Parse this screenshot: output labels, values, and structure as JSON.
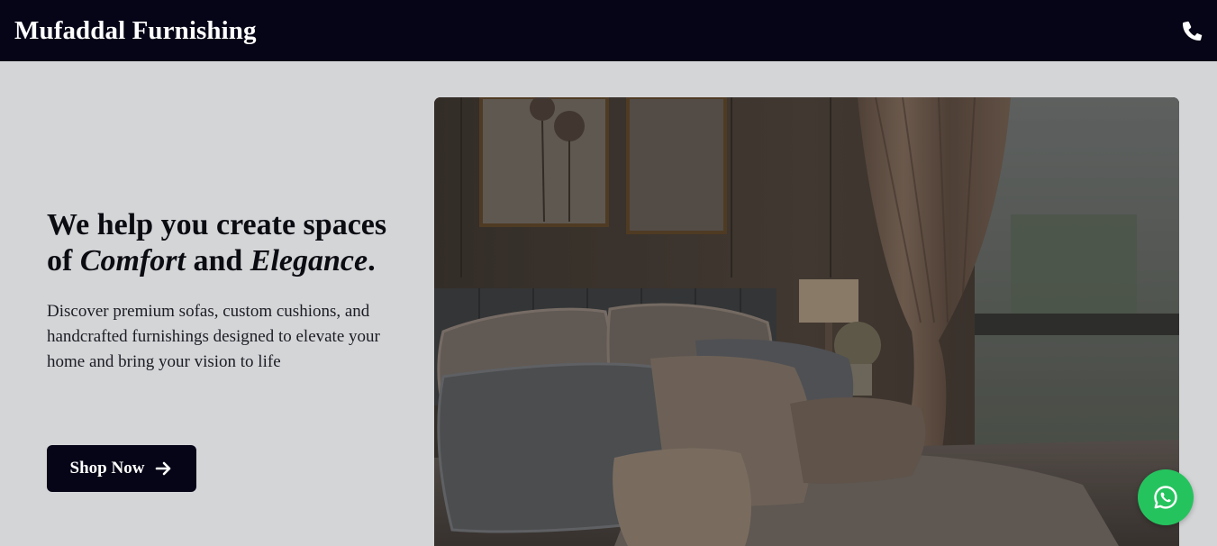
{
  "navbar": {
    "brand": "Mufaddal Furnishing",
    "phone_icon": "phone-icon"
  },
  "hero": {
    "headline_part1": "We help you create spaces of ",
    "headline_italic1": "Comfort",
    "headline_part2": " and ",
    "headline_italic2": "Elegance",
    "headline_end": ".",
    "description": "Discover premium sofas, custom cushions, and handcrafted furnishings designed to elevate your home and bring your vision to life",
    "cta_label": "Shop Now",
    "cta_icon": "arrow-right-icon",
    "image_subject": "bedroom-with-pillows-and-curtains"
  },
  "floating": {
    "whatsapp_icon": "whatsapp-icon",
    "whatsapp_color": "#25c35e"
  },
  "colors": {
    "navbar_bg": "#060517",
    "page_bg": "#d4d5d7",
    "button_bg": "#060517"
  }
}
